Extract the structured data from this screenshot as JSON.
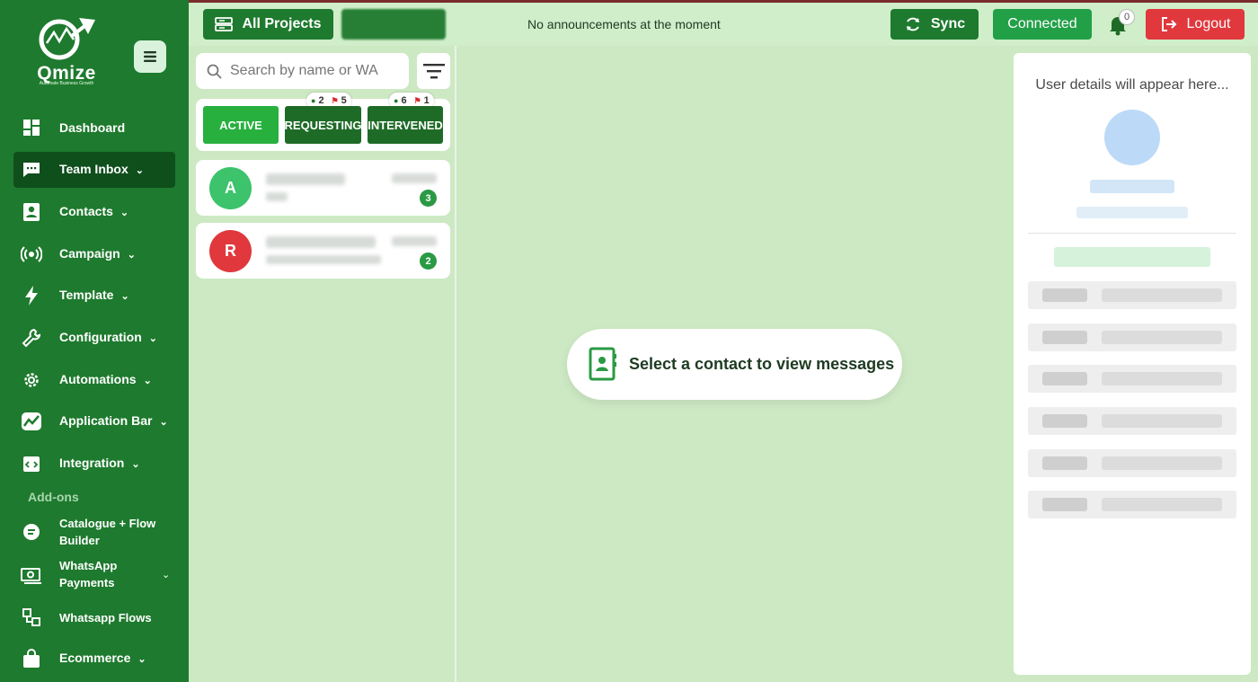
{
  "brand": {
    "name": "Qmize",
    "tagline": "Automate Business Growth"
  },
  "colors": {
    "sidebar": "#1e7a2e",
    "active_nav": "#0f4f1c",
    "accent_green": "#28b03f",
    "logout_red": "#e0383d",
    "background": "#cde9c4"
  },
  "sidebar": {
    "items": [
      {
        "label": "Dashboard",
        "icon": "dashboard-icon",
        "chevron": false
      },
      {
        "label": "Team Inbox",
        "icon": "chat-icon",
        "chevron": true,
        "active": true
      },
      {
        "label": "Contacts",
        "icon": "contacts-icon",
        "chevron": true
      },
      {
        "label": "Campaign",
        "icon": "broadcast-icon",
        "chevron": true
      },
      {
        "label": "Template",
        "icon": "lightning-icon",
        "chevron": true
      },
      {
        "label": "Configuration",
        "icon": "wrench-icon",
        "chevron": true
      },
      {
        "label": "Automations",
        "icon": "gear-icon",
        "chevron": true
      },
      {
        "label": "Application Bar",
        "icon": "chart-icon",
        "chevron": true
      },
      {
        "label": "Integration",
        "icon": "code-icon",
        "chevron": true
      }
    ],
    "addons_label": "Add-ons",
    "addons": [
      {
        "label": "Catalogue + Flow Builder",
        "icon": "catalogue-icon"
      },
      {
        "label": "WhatsApp Payments",
        "icon": "money-icon",
        "chevron": true
      },
      {
        "label": "Whatsapp Flows",
        "icon": "flows-icon"
      },
      {
        "label": "Ecommerce",
        "icon": "bag-icon",
        "chevron": true
      }
    ]
  },
  "header": {
    "all_projects": "All Projects",
    "announcement": "No announcements at the moment",
    "sync": "Sync",
    "connected": "Connected",
    "notifications": "0",
    "logout": "Logout"
  },
  "search": {
    "placeholder": "Search by name or WA"
  },
  "tabs": {
    "active": "ACTIVE",
    "requesting": {
      "label": "REQUESTING",
      "users": "2",
      "flags": "5"
    },
    "intervened": {
      "label": "INTERVENED",
      "users": "6",
      "flags": "1"
    }
  },
  "contacts": [
    {
      "initial": "A",
      "avatar_color": "#3cc36c",
      "unread": "3"
    },
    {
      "initial": "R",
      "avatar_color": "#e0383d",
      "unread": "2"
    }
  ],
  "main": {
    "placeholder": "Select a contact to view messages"
  },
  "details": {
    "placeholder": "User details will appear here..."
  }
}
